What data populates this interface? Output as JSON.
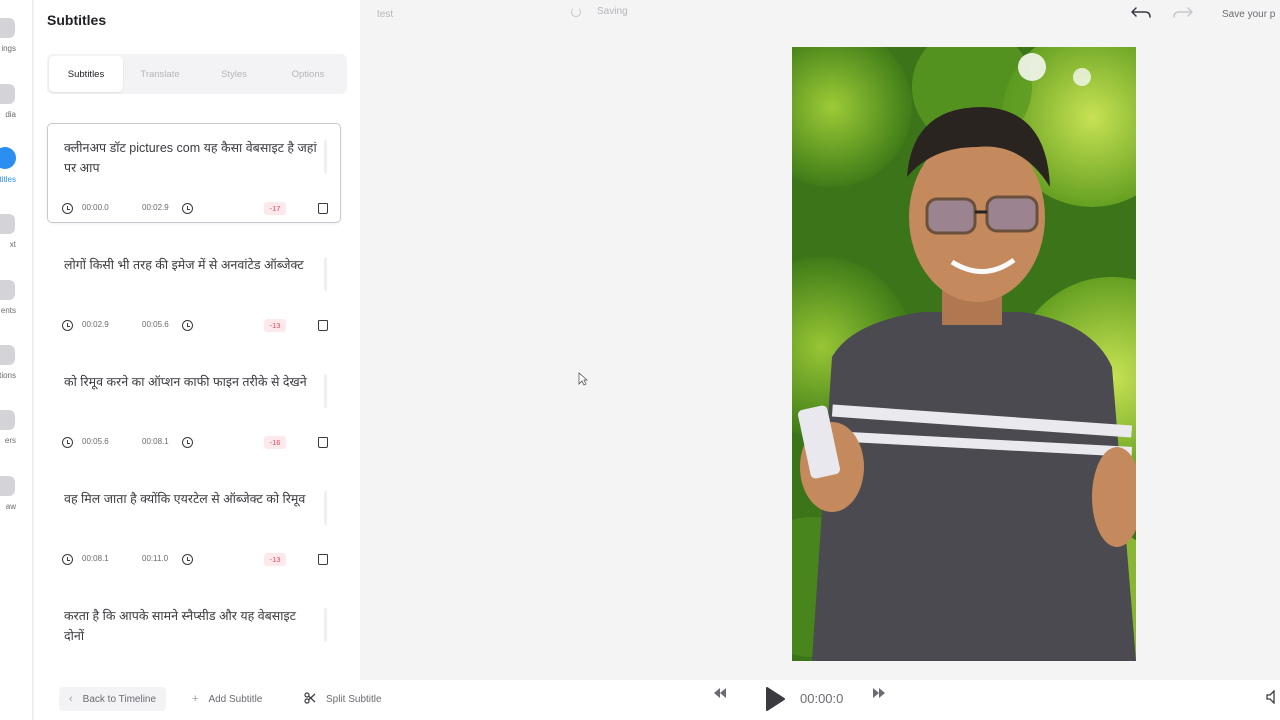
{
  "rail": {
    "items": [
      {
        "label": "ings",
        "icon": "settings-icon",
        "active": false
      },
      {
        "label": "dia",
        "icon": "media-icon",
        "active": false
      },
      {
        "label": "btitles",
        "icon": "subtitles-icon",
        "active": true
      },
      {
        "label": "xt",
        "icon": "text-icon",
        "active": false
      },
      {
        "label": "ents",
        "icon": "elements-icon",
        "active": false
      },
      {
        "label": "itions",
        "icon": "transitions-icon",
        "active": false
      },
      {
        "label": "ers",
        "icon": "filters-icon",
        "active": false
      },
      {
        "label": "aw",
        "icon": "draw-icon",
        "active": false
      }
    ]
  },
  "panel": {
    "title": "Subtitles",
    "tabs": [
      "Subtitles",
      "Translate",
      "Styles",
      "Options"
    ],
    "active_tab": "Subtitles"
  },
  "subtitles": [
    {
      "text": "क्लीनअप डॉट pictures com यह कैसा वेबसाइट है जहां पर आप",
      "start": "00:00.0",
      "end": "00:02.9",
      "badge": "-17"
    },
    {
      "text": "लोगों किसी भी तरह की इमेज में से अनवांटेड ऑब्जेक्ट",
      "start": "00:02.9",
      "end": "00:05.6",
      "badge": "-13"
    },
    {
      "text": "को रिमूव करने का ऑप्शन काफी फाइन तरीके से देखने",
      "start": "00:05.6",
      "end": "00:08.1",
      "badge": "-16"
    },
    {
      "text": "वह मिल जाता है क्योंकि एयरटेल से ऑब्जेक्ट को रिमूव",
      "start": "00:08.1",
      "end": "00:11.0",
      "badge": "-13"
    },
    {
      "text": "करता है कि आपके सामने स्नैप्सीड और यह वेबसाइट दोनों",
      "start": "",
      "end": "",
      "badge": ""
    }
  ],
  "bottombar": {
    "back": "Back to Timeline",
    "add": "Add Subtitle",
    "split": "Split Subtitle"
  },
  "topbar": {
    "project_name": "test",
    "status": "Saving",
    "save_project": "Save your p"
  },
  "player": {
    "timecode": "00:00:0"
  },
  "colors": {
    "accent": "#2b8ef0",
    "badge_bg": "#fde9ec",
    "badge_text": "#e8475f"
  }
}
